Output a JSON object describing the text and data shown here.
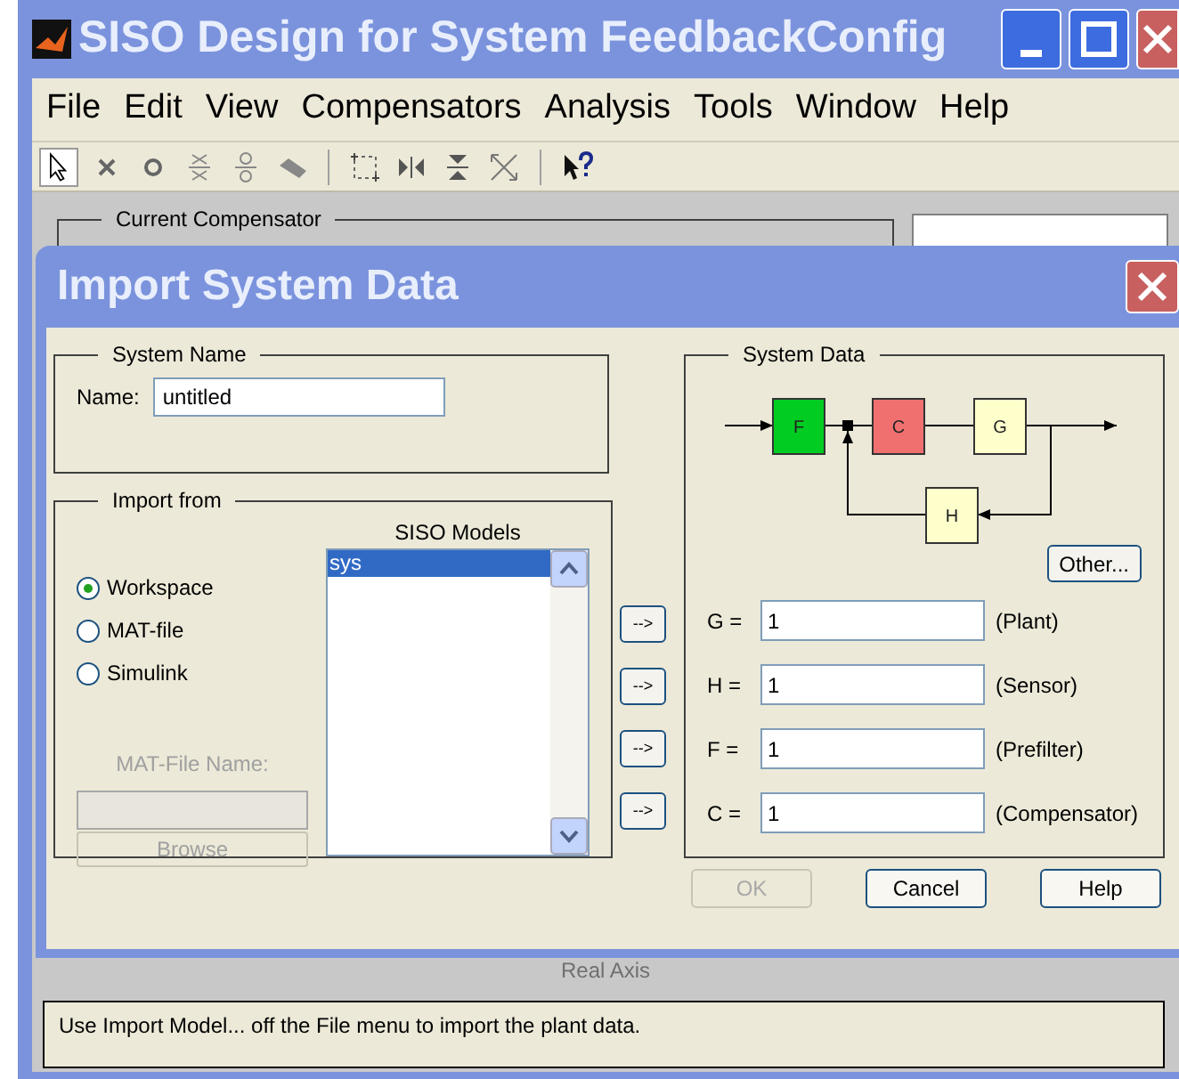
{
  "window": {
    "title": "SISO Design for System FeedbackConfig"
  },
  "menu": [
    "File",
    "Edit",
    "View",
    "Compensators",
    "Analysis",
    "Tools",
    "Window",
    "Help"
  ],
  "background_panel": {
    "title": "Current Compensator"
  },
  "axis_label": "Real Axis",
  "status": "Use Import Model... off the File menu to import the plant data.",
  "dialog": {
    "title": "Import System Data",
    "system_name": {
      "title": "System Name",
      "label": "Name:",
      "value": "untitled"
    },
    "import_from": {
      "title": "Import from",
      "options": [
        {
          "label": "Workspace",
          "selected": true
        },
        {
          "label": "MAT-file",
          "selected": false
        },
        {
          "label": "Simulink",
          "selected": false
        }
      ],
      "mat_file_label": "MAT-File Name:",
      "mat_file_disabled": true,
      "browse": "Browse",
      "browse_disabled": true,
      "models_title": "SISO Models",
      "models": [
        {
          "label": "sys",
          "selected": true
        }
      ]
    },
    "transfer_buttons": [
      "-->",
      "-->",
      "-->",
      "-->"
    ],
    "system_data": {
      "title": "System Data",
      "blocks": [
        {
          "label": "F",
          "color": "#00cc22"
        },
        {
          "label": "C",
          "color": "#f07070"
        },
        {
          "label": "G",
          "color": "#ffffcc"
        },
        {
          "label": "H",
          "color": "#ffffcc"
        }
      ],
      "other_button": "Other...",
      "fields": [
        {
          "name": "G =",
          "value": "1",
          "note": "(Plant)"
        },
        {
          "name": "H =",
          "value": "1",
          "note": "(Sensor)"
        },
        {
          "name": "F =",
          "value": "1",
          "note": "(Prefilter)"
        },
        {
          "name": "C =",
          "value": "1",
          "note": "(Compensator)"
        }
      ]
    },
    "buttons": [
      {
        "label": "OK",
        "disabled": true
      },
      {
        "label": "Cancel",
        "disabled": false
      },
      {
        "label": "Help",
        "disabled": false
      }
    ]
  }
}
